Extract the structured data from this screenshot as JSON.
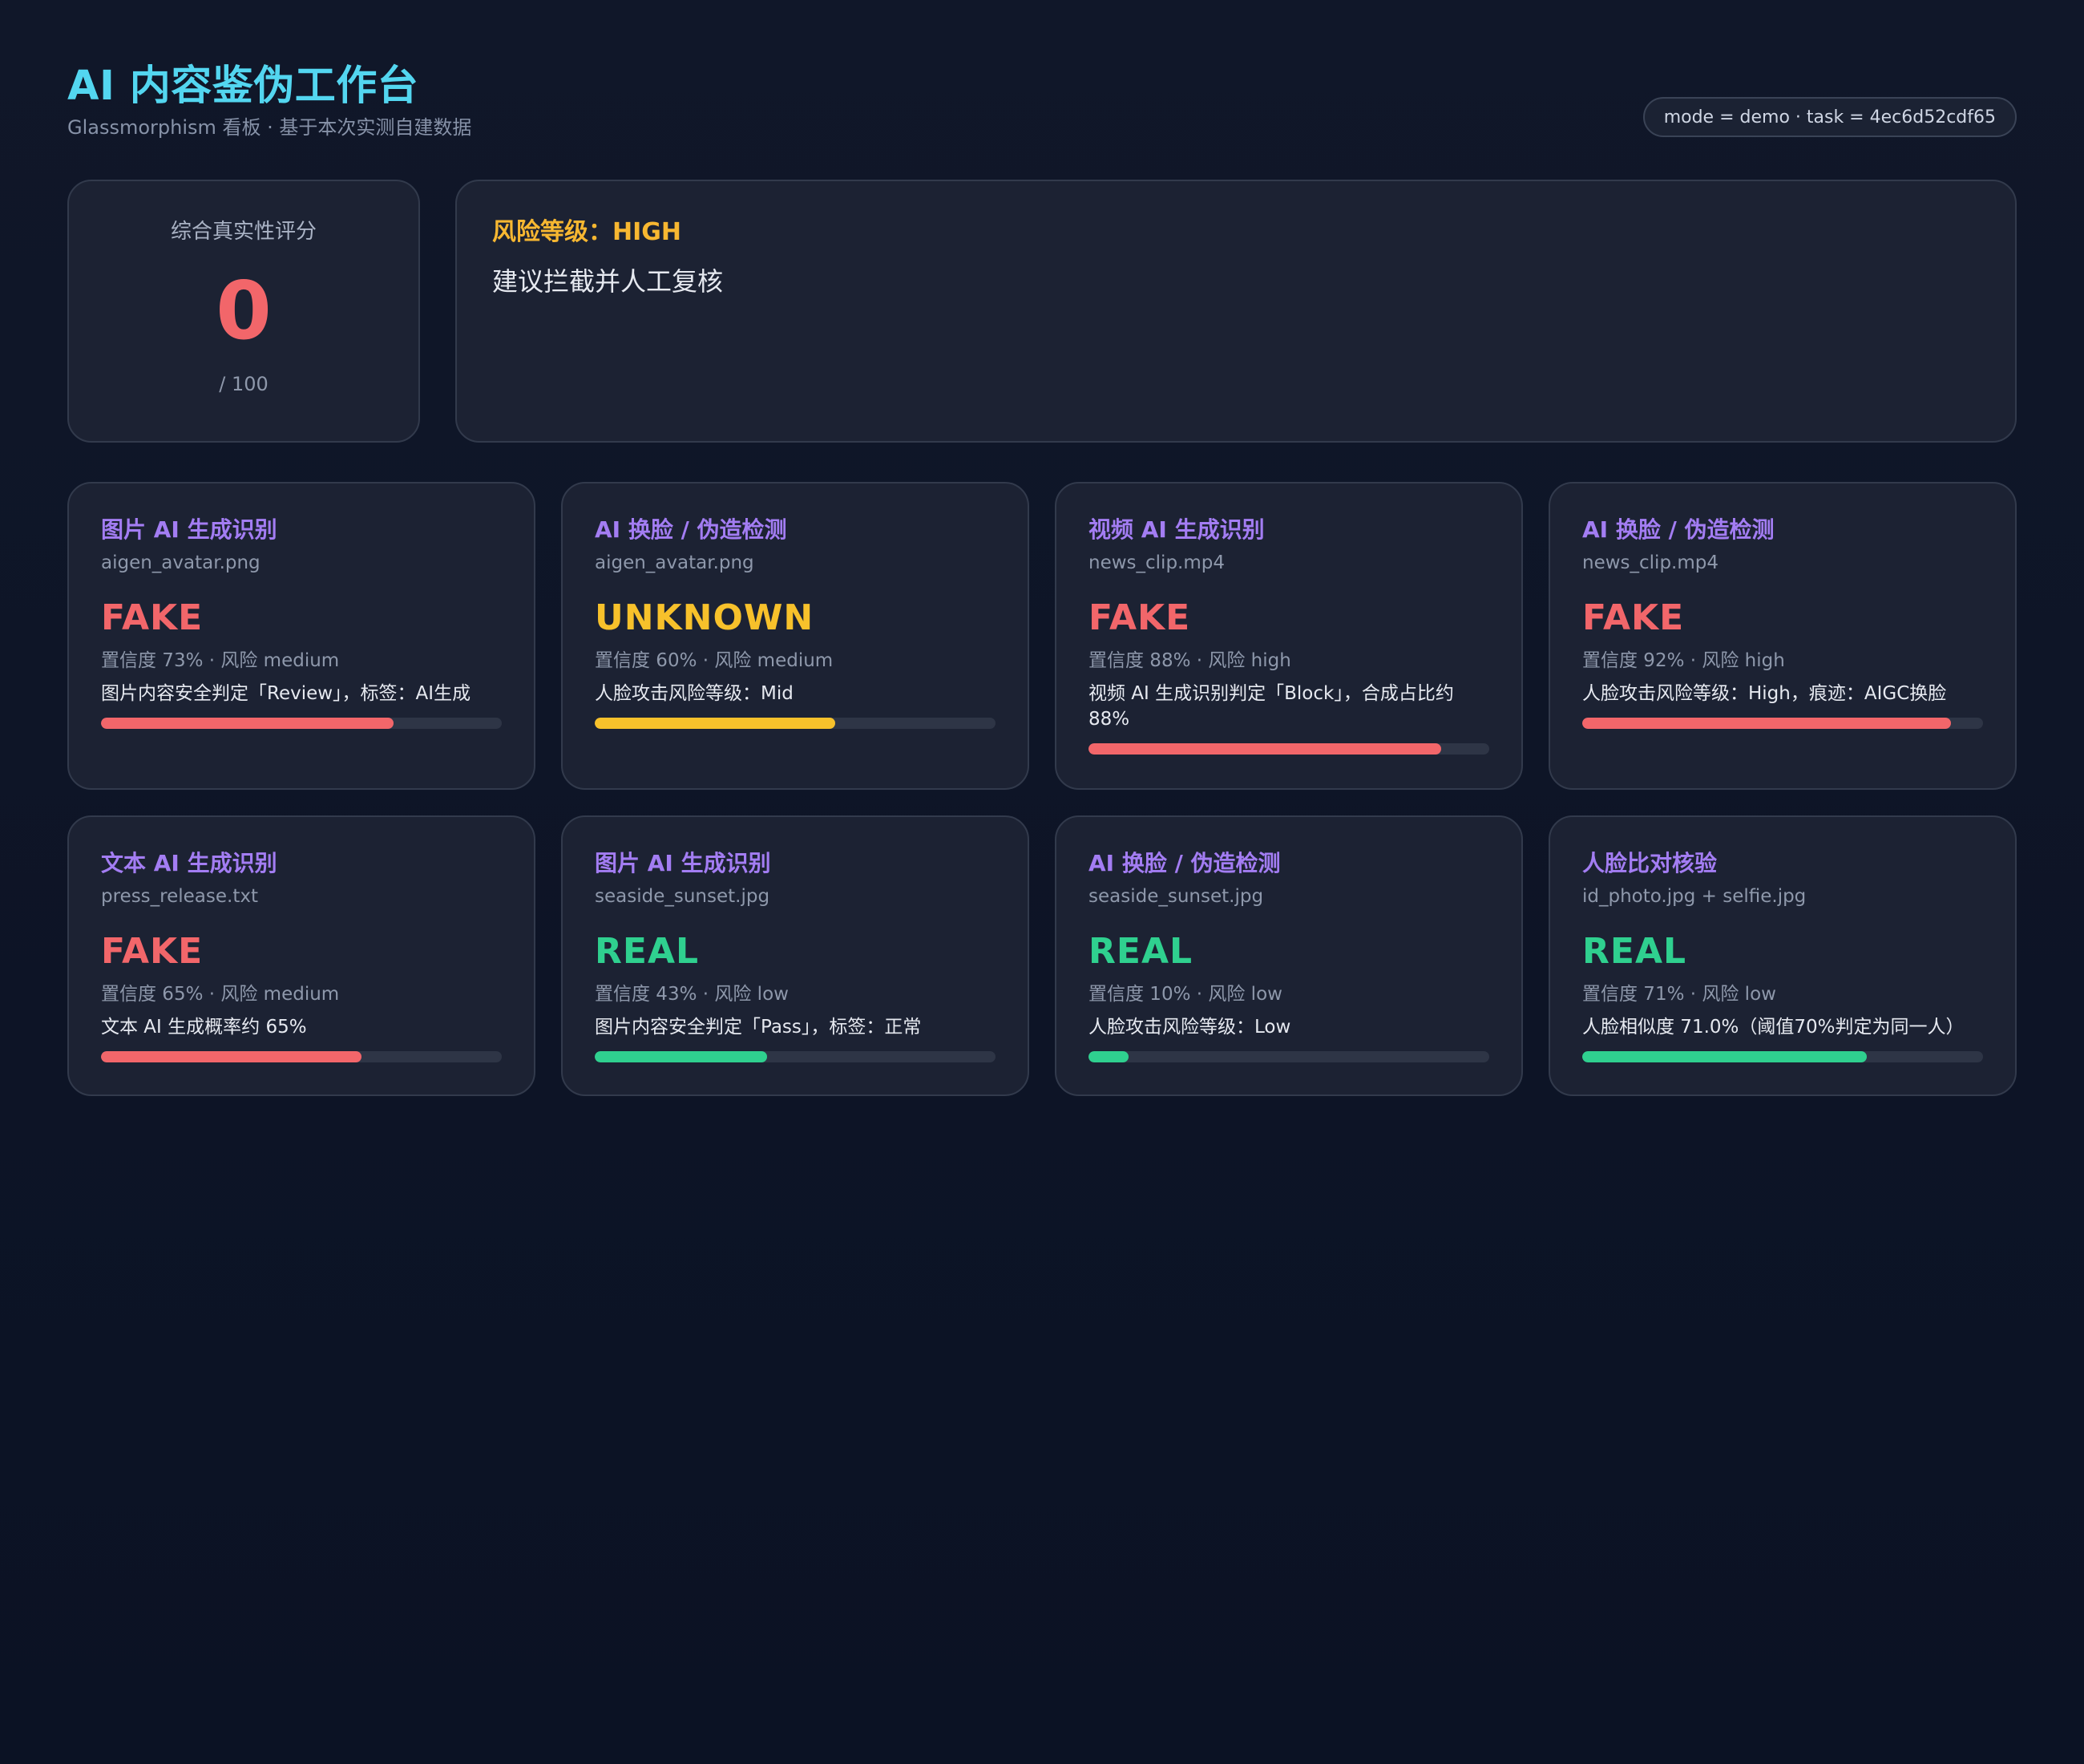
{
  "header": {
    "title": "AI 内容鉴伪工作台",
    "subtitle": "Glassmorphism 看板 · 基于本次实测自建数据",
    "mode_pill": "mode = demo · task = 4ec6d52cdf65"
  },
  "summary": {
    "score_label": "综合真实性评分",
    "score_value": "0",
    "score_max": "/ 100",
    "risk_level": "风险等级：HIGH",
    "risk_advice": "建议拦截并人工复核"
  },
  "colors": {
    "fake": "#f2666a",
    "unknown": "#f7c12b",
    "real": "#2fd08f",
    "title_accent": "#53d6f0",
    "card_title": "#a37df3",
    "risk": "#f7b731"
  },
  "cards": [
    {
      "title": "图片 AI 生成识别",
      "file": "aigen_avatar.png",
      "verdict": "FAKE",
      "status": "fake",
      "meta": "置信度 73% · 风险 medium",
      "desc": "图片内容安全判定「Review」，标签：AI生成",
      "confidence": 73
    },
    {
      "title": "AI 换脸 / 伪造检测",
      "file": "aigen_avatar.png",
      "verdict": "UNKNOWN",
      "status": "unknown",
      "meta": "置信度 60% · 风险 medium",
      "desc": "人脸攻击风险等级：Mid",
      "confidence": 60
    },
    {
      "title": "视频 AI 生成识别",
      "file": "news_clip.mp4",
      "verdict": "FAKE",
      "status": "fake",
      "meta": "置信度 88% · 风险 high",
      "desc": "视频 AI 生成识别判定「Block」，合成占比约 88%",
      "confidence": 88
    },
    {
      "title": "AI 换脸 / 伪造检测",
      "file": "news_clip.mp4",
      "verdict": "FAKE",
      "status": "fake",
      "meta": "置信度 92% · 风险 high",
      "desc": "人脸攻击风险等级：High，痕迹：AIGC换脸",
      "confidence": 92
    },
    {
      "title": "文本 AI 生成识别",
      "file": "press_release.txt",
      "verdict": "FAKE",
      "status": "fake",
      "meta": "置信度 65% · 风险 medium",
      "desc": "文本 AI 生成概率约 65%",
      "confidence": 65
    },
    {
      "title": "图片 AI 生成识别",
      "file": "seaside_sunset.jpg",
      "verdict": "REAL",
      "status": "real",
      "meta": "置信度 43% · 风险 low",
      "desc": "图片内容安全判定「Pass」，标签：正常",
      "confidence": 43
    },
    {
      "title": "AI 换脸 / 伪造检测",
      "file": "seaside_sunset.jpg",
      "verdict": "REAL",
      "status": "real",
      "meta": "置信度 10% · 风险 low",
      "desc": "人脸攻击风险等级：Low",
      "confidence": 10
    },
    {
      "title": "人脸比对核验",
      "file": "id_photo.jpg + selfie.jpg",
      "verdict": "REAL",
      "status": "real",
      "meta": "置信度 71% · 风险 low",
      "desc": "人脸相似度 71.0%（阈值70%判定为同一人）",
      "confidence": 71
    }
  ]
}
